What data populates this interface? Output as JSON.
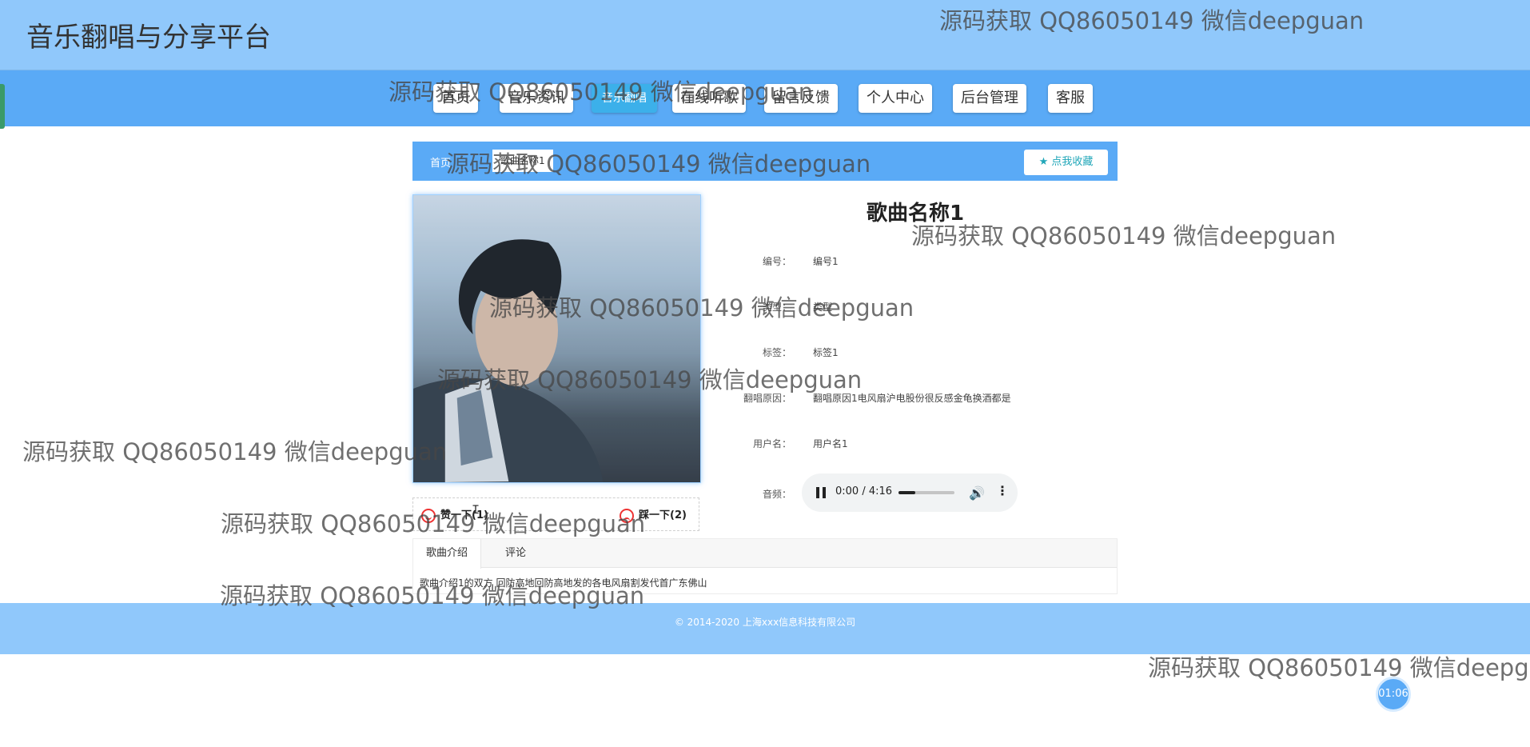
{
  "site": {
    "title": "音乐翻唱与分享平台"
  },
  "nav": {
    "items": [
      {
        "label": "首页"
      },
      {
        "label": "音乐资讯"
      },
      {
        "label": "音乐翻唱"
      },
      {
        "label": "在线听歌"
      },
      {
        "label": "留言反馈"
      },
      {
        "label": "个人中心"
      },
      {
        "label": "后台管理"
      },
      {
        "label": "客服"
      }
    ],
    "active_index": 2
  },
  "breadcrumb": {
    "home": "首页",
    "current": "歌曲名称1"
  },
  "favorite_button": {
    "icon": "star-icon",
    "label": "点我收藏"
  },
  "song": {
    "title": "歌曲名称1",
    "fields": [
      {
        "label": "编号：",
        "value": "编号1"
      },
      {
        "label": "类型：",
        "value": "类型"
      },
      {
        "label": "标签：",
        "value": "标签1"
      },
      {
        "label": "翻唱原因：",
        "value": "翻唱原因1电风扇沪电股份很反感金龟换酒都是"
      },
      {
        "label": "用户名：",
        "value": "用户名1"
      }
    ],
    "audio_label": "音频：",
    "audio": {
      "time": "0:00 / 4:16",
      "progress": 0.3
    }
  },
  "votes": {
    "up": "赞一下(1)",
    "down": "踩一下(2)"
  },
  "tabs": {
    "items": [
      {
        "label": "歌曲介绍"
      },
      {
        "label": "评论"
      }
    ],
    "content": "歌曲介绍1的双方 回防高地回防高地发的各电风扇割发代首广东佛山"
  },
  "footer": {
    "text": "© 2014-2020 上海xxx信息科技有限公司"
  },
  "timer": {
    "text": "01:06"
  },
  "watermark": "源码获取 QQ86050149 微信deepguan",
  "colors": {
    "topbar": "#90c8fb",
    "navbar": "#5aaaf6",
    "active_nav": "#3cb0ea",
    "favorite_text": "#1fa6b8",
    "vote_icon": "#e33333"
  }
}
